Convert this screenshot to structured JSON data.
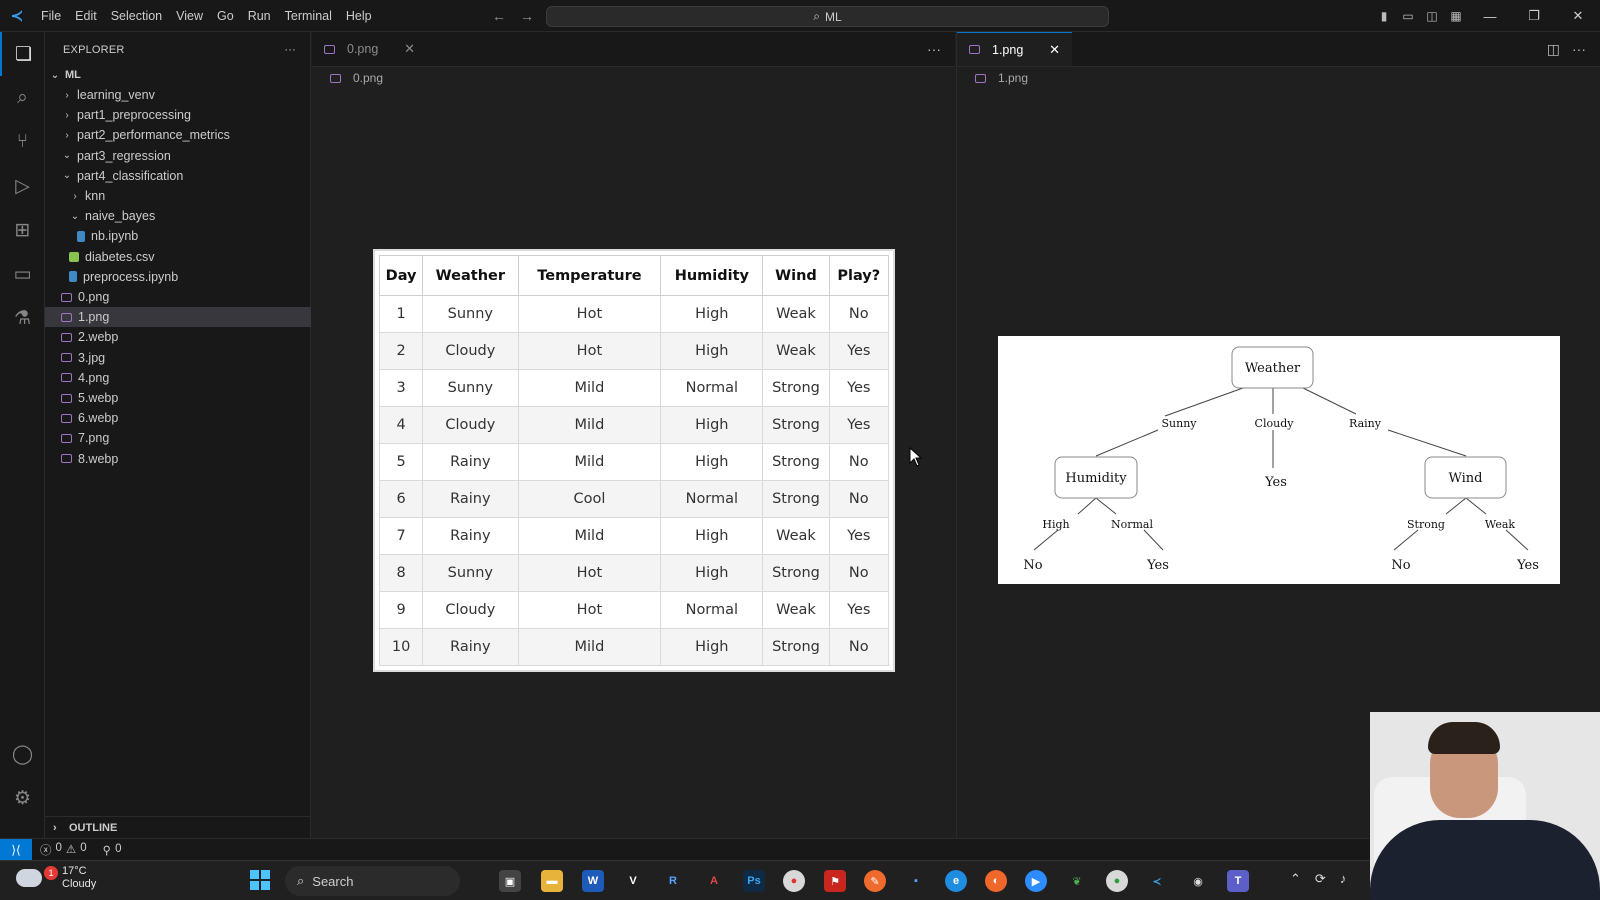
{
  "titlebar": {
    "menu": [
      "File",
      "Edit",
      "Selection",
      "View",
      "Go",
      "Run",
      "Terminal",
      "Help"
    ],
    "search": "ML"
  },
  "sidebar": {
    "title": "EXPLORER",
    "root": "ML",
    "items": [
      {
        "label": "learning_venv",
        "kind": "folder",
        "open": false,
        "depth": 1
      },
      {
        "label": "part1_preprocessing",
        "kind": "folder",
        "open": false,
        "depth": 1
      },
      {
        "label": "part2_performance_metrics",
        "kind": "folder",
        "open": false,
        "depth": 1
      },
      {
        "label": "part3_regression",
        "kind": "folder",
        "open": true,
        "depth": 1
      },
      {
        "label": "part4_classification",
        "kind": "folder",
        "open": true,
        "depth": 1
      },
      {
        "label": "knn",
        "kind": "folder",
        "open": false,
        "depth": 2
      },
      {
        "label": "naive_bayes",
        "kind": "folder",
        "open": true,
        "depth": 2
      },
      {
        "label": "nb.ipynb",
        "kind": "notebook",
        "depth": 3
      },
      {
        "label": "diabetes.csv",
        "kind": "csv",
        "depth": 2
      },
      {
        "label": "preprocess.ipynb",
        "kind": "notebook",
        "depth": 2
      },
      {
        "label": "0.png",
        "kind": "image",
        "depth": 1
      },
      {
        "label": "1.png",
        "kind": "image",
        "depth": 1,
        "selected": true
      },
      {
        "label": "2.webp",
        "kind": "image",
        "depth": 1
      },
      {
        "label": "3.jpg",
        "kind": "image",
        "depth": 1
      },
      {
        "label": "4.png",
        "kind": "image",
        "depth": 1
      },
      {
        "label": "5.webp",
        "kind": "image",
        "depth": 1
      },
      {
        "label": "6.webp",
        "kind": "image",
        "depth": 1
      },
      {
        "label": "7.png",
        "kind": "image",
        "depth": 1
      },
      {
        "label": "8.webp",
        "kind": "image",
        "depth": 1
      }
    ],
    "outline": "OUTLINE"
  },
  "editor_left": {
    "tab": "0.png",
    "breadcrumb": "0.png",
    "table": {
      "headers": [
        "Day",
        "Weather",
        "Temperature",
        "Humidity",
        "Wind",
        "Play?"
      ],
      "rows": [
        [
          "1",
          "Sunny",
          "Hot",
          "High",
          "Weak",
          "No"
        ],
        [
          "2",
          "Cloudy",
          "Hot",
          "High",
          "Weak",
          "Yes"
        ],
        [
          "3",
          "Sunny",
          "Mild",
          "Normal",
          "Strong",
          "Yes"
        ],
        [
          "4",
          "Cloudy",
          "Mild",
          "High",
          "Strong",
          "Yes"
        ],
        [
          "5",
          "Rainy",
          "Mild",
          "High",
          "Strong",
          "No"
        ],
        [
          "6",
          "Rainy",
          "Cool",
          "Normal",
          "Strong",
          "No"
        ],
        [
          "7",
          "Rainy",
          "Mild",
          "High",
          "Weak",
          "Yes"
        ],
        [
          "8",
          "Sunny",
          "Hot",
          "High",
          "Strong",
          "No"
        ],
        [
          "9",
          "Cloudy",
          "Hot",
          "Normal",
          "Weak",
          "Yes"
        ],
        [
          "10",
          "Rainy",
          "Mild",
          "High",
          "Strong",
          "No"
        ]
      ]
    }
  },
  "editor_right": {
    "tab": "1.png",
    "breadcrumb": "1.png",
    "tree": {
      "root": "Weather",
      "branch_sunny": "Sunny",
      "branch_cloudy": "Cloudy",
      "branch_rainy": "Rainy",
      "node_humidity": "Humidity",
      "leaf_cloudy": "Yes",
      "node_wind": "Wind",
      "branch_high": "High",
      "branch_normal": "Normal",
      "leaf_high": "No",
      "leaf_normal": "Yes",
      "branch_strong": "Strong",
      "branch_weak": "Weak",
      "leaf_strong": "No",
      "leaf_weak": "Yes"
    }
  },
  "statusbar": {
    "errors": "0",
    "warnings": "0",
    "ports": "0"
  },
  "taskbar": {
    "temperature": "17°C",
    "condition": "Cloudy",
    "notification_count": "1",
    "search": "Search"
  },
  "colors": {
    "accent": "#0078d4",
    "editor_bg": "#1f1f1f",
    "sidebar_bg": "#181818"
  }
}
